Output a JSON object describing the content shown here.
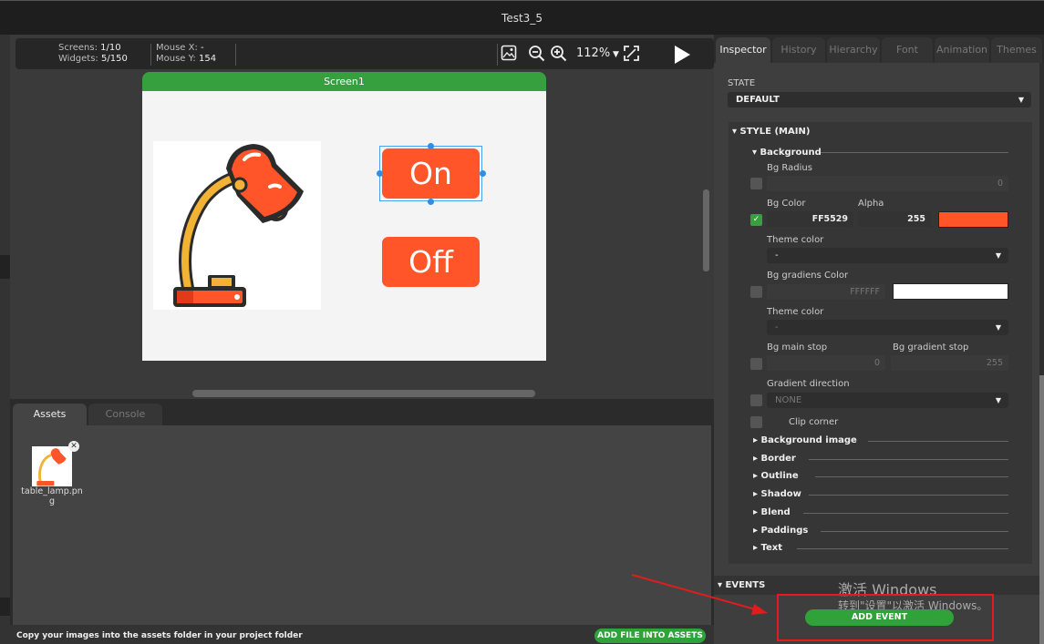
{
  "window": {
    "title": "Test3_5"
  },
  "toolbar": {
    "screens_label": "Screens:",
    "screens_value": "1/10",
    "widgets_label": "Widgets:",
    "widgets_value": "5/150",
    "mouse_x_label": "Mouse X:",
    "mouse_x_value": "-",
    "mouse_y_label": "Mouse Y:",
    "mouse_y_value": "154",
    "zoom": "112%"
  },
  "canvas": {
    "screen_name": "Screen1",
    "button_on": "On",
    "button_off": "Off"
  },
  "assets": {
    "tabs": [
      "Assets",
      "Console"
    ],
    "files": [
      {
        "name": "table_lamp.png"
      }
    ],
    "hint": "Copy your images into the assets folder in your project folder",
    "add_file_button": "ADD FILE INTO ASSETS"
  },
  "panel": {
    "tabs": [
      "Inspector",
      "History",
      "Hierarchy",
      "Font",
      "Animation",
      "Themes"
    ]
  },
  "inspector": {
    "state_label": "STATE",
    "state_value": "DEFAULT",
    "style_header": "STYLE (MAIN)",
    "background_header": "Background",
    "bg_radius_label": "Bg Radius",
    "bg_radius_value": "0",
    "bg_color_label": "Bg Color",
    "bg_color_value": "FF5529",
    "alpha_label": "Alpha",
    "alpha_value": "255",
    "bg_color_swatch": "#FF5529",
    "theme_color_label": "Theme color",
    "theme_color_value": "-",
    "bg_grad_color_label": "Bg gradiens Color",
    "bg_grad_color_value": "FFFFFF",
    "bg_grad_swatch": "#FFFFFF",
    "theme_color2_label": "Theme color",
    "theme_color2_value": "-",
    "bg_main_stop_label": "Bg main stop",
    "bg_main_stop_value": "0",
    "bg_grad_stop_label": "Bg gradient stop",
    "bg_grad_stop_value": "255",
    "grad_dir_label": "Gradient direction",
    "grad_dir_value": "NONE",
    "clip_corner_label": "Clip corner",
    "sections": [
      "Background image",
      "Border",
      "Outline",
      "Shadow",
      "Blend",
      "Paddings",
      "Text"
    ],
    "events_header": "EVENTS",
    "add_event_button": "ADD EVENT"
  },
  "watermark": {
    "line1": "激活 Windows",
    "line2": "转到\"设置\"以激活 Windows。"
  },
  "colors": {
    "accent_green": "#36a03f",
    "button_red": "#ff5529",
    "selection_blue": "#2f8fe6",
    "annotation_red": "#e21c1c"
  }
}
